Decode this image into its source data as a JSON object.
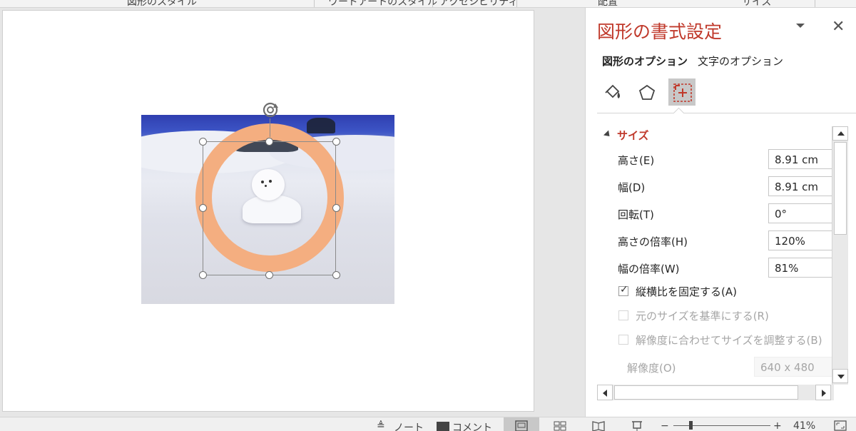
{
  "ribbon": {
    "groups": [
      "図形のスタイル",
      "ワードアートのスタイル",
      "アクセシビリティ",
      "配置",
      "サイズ"
    ]
  },
  "pane": {
    "title": "図形の書式設定",
    "close_glyph": "✕",
    "tabs": [
      "図形のオプション",
      "文字のオプション"
    ],
    "section_title": "サイズ",
    "fields": [
      {
        "label": "高さ(E)",
        "value": "8.91 cm"
      },
      {
        "label": "幅(D)",
        "value": "8.91 cm"
      },
      {
        "label": "回転(T)",
        "value": "0°"
      },
      {
        "label": "高さの倍率(H)",
        "value": "120%"
      },
      {
        "label": "幅の倍率(W)",
        "value": "81%"
      }
    ],
    "checkboxes": [
      {
        "label": "縦横比を固定する(A)",
        "checked": true,
        "enabled": true
      },
      {
        "label": "元のサイズを基準にする(R)",
        "checked": false,
        "enabled": false
      },
      {
        "label": "解像度に合わせてサイズを調整する(B)",
        "checked": false,
        "enabled": false
      }
    ],
    "resolution": {
      "label": "解像度(O)",
      "value": "640 x 480"
    },
    "icons": [
      "fill-line-icon",
      "effects-icon",
      "size-properties-icon"
    ]
  },
  "status": {
    "notes": "ノート",
    "comments": "コメント",
    "zoom": "41%",
    "zoom_minus": "−",
    "zoom_plus": "+"
  },
  "colors": {
    "accent": "#c0392b",
    "ring": "#f4ae80",
    "sky": "#3d55c6"
  }
}
